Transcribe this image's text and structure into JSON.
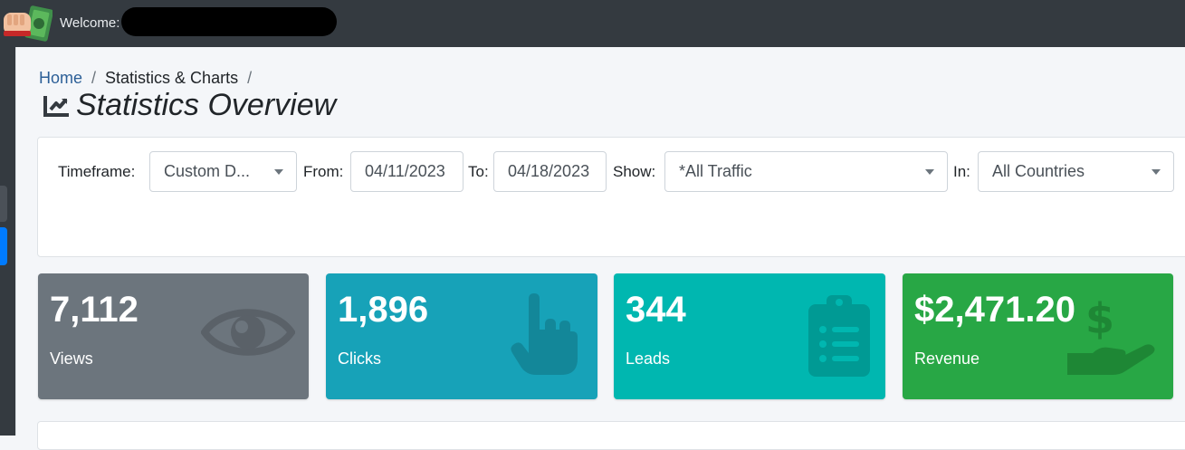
{
  "header": {
    "welcome_label": "Welcome:"
  },
  "breadcrumb": {
    "home": "Home",
    "separator": "/",
    "current": "Statistics & Charts"
  },
  "page": {
    "title": "Statistics Overview",
    "title_icon": "chart-line-icon"
  },
  "filters": {
    "timeframe_label": "Timeframe:",
    "timeframe_value": "Custom D...",
    "from_label": "From:",
    "from_value": "04/11/2023",
    "to_label": "To:",
    "to_value": "04/18/2023",
    "show_label": "Show:",
    "show_value": "*All Traffic",
    "in_label": "In:",
    "in_value": "All Countries"
  },
  "stats": [
    {
      "value": "7,112",
      "label": "Views",
      "icon": "eye-icon",
      "color": "#6c757d"
    },
    {
      "value": "1,896",
      "label": "Clicks",
      "icon": "pointer-hand-icon",
      "color": "#17a2b8"
    },
    {
      "value": "344",
      "label": "Leads",
      "icon": "clipboard-list-icon",
      "color": "#00b7b0"
    },
    {
      "value": "$2,471.20",
      "label": "Revenue",
      "icon": "hand-dollar-icon",
      "color": "#28a745"
    }
  ]
}
